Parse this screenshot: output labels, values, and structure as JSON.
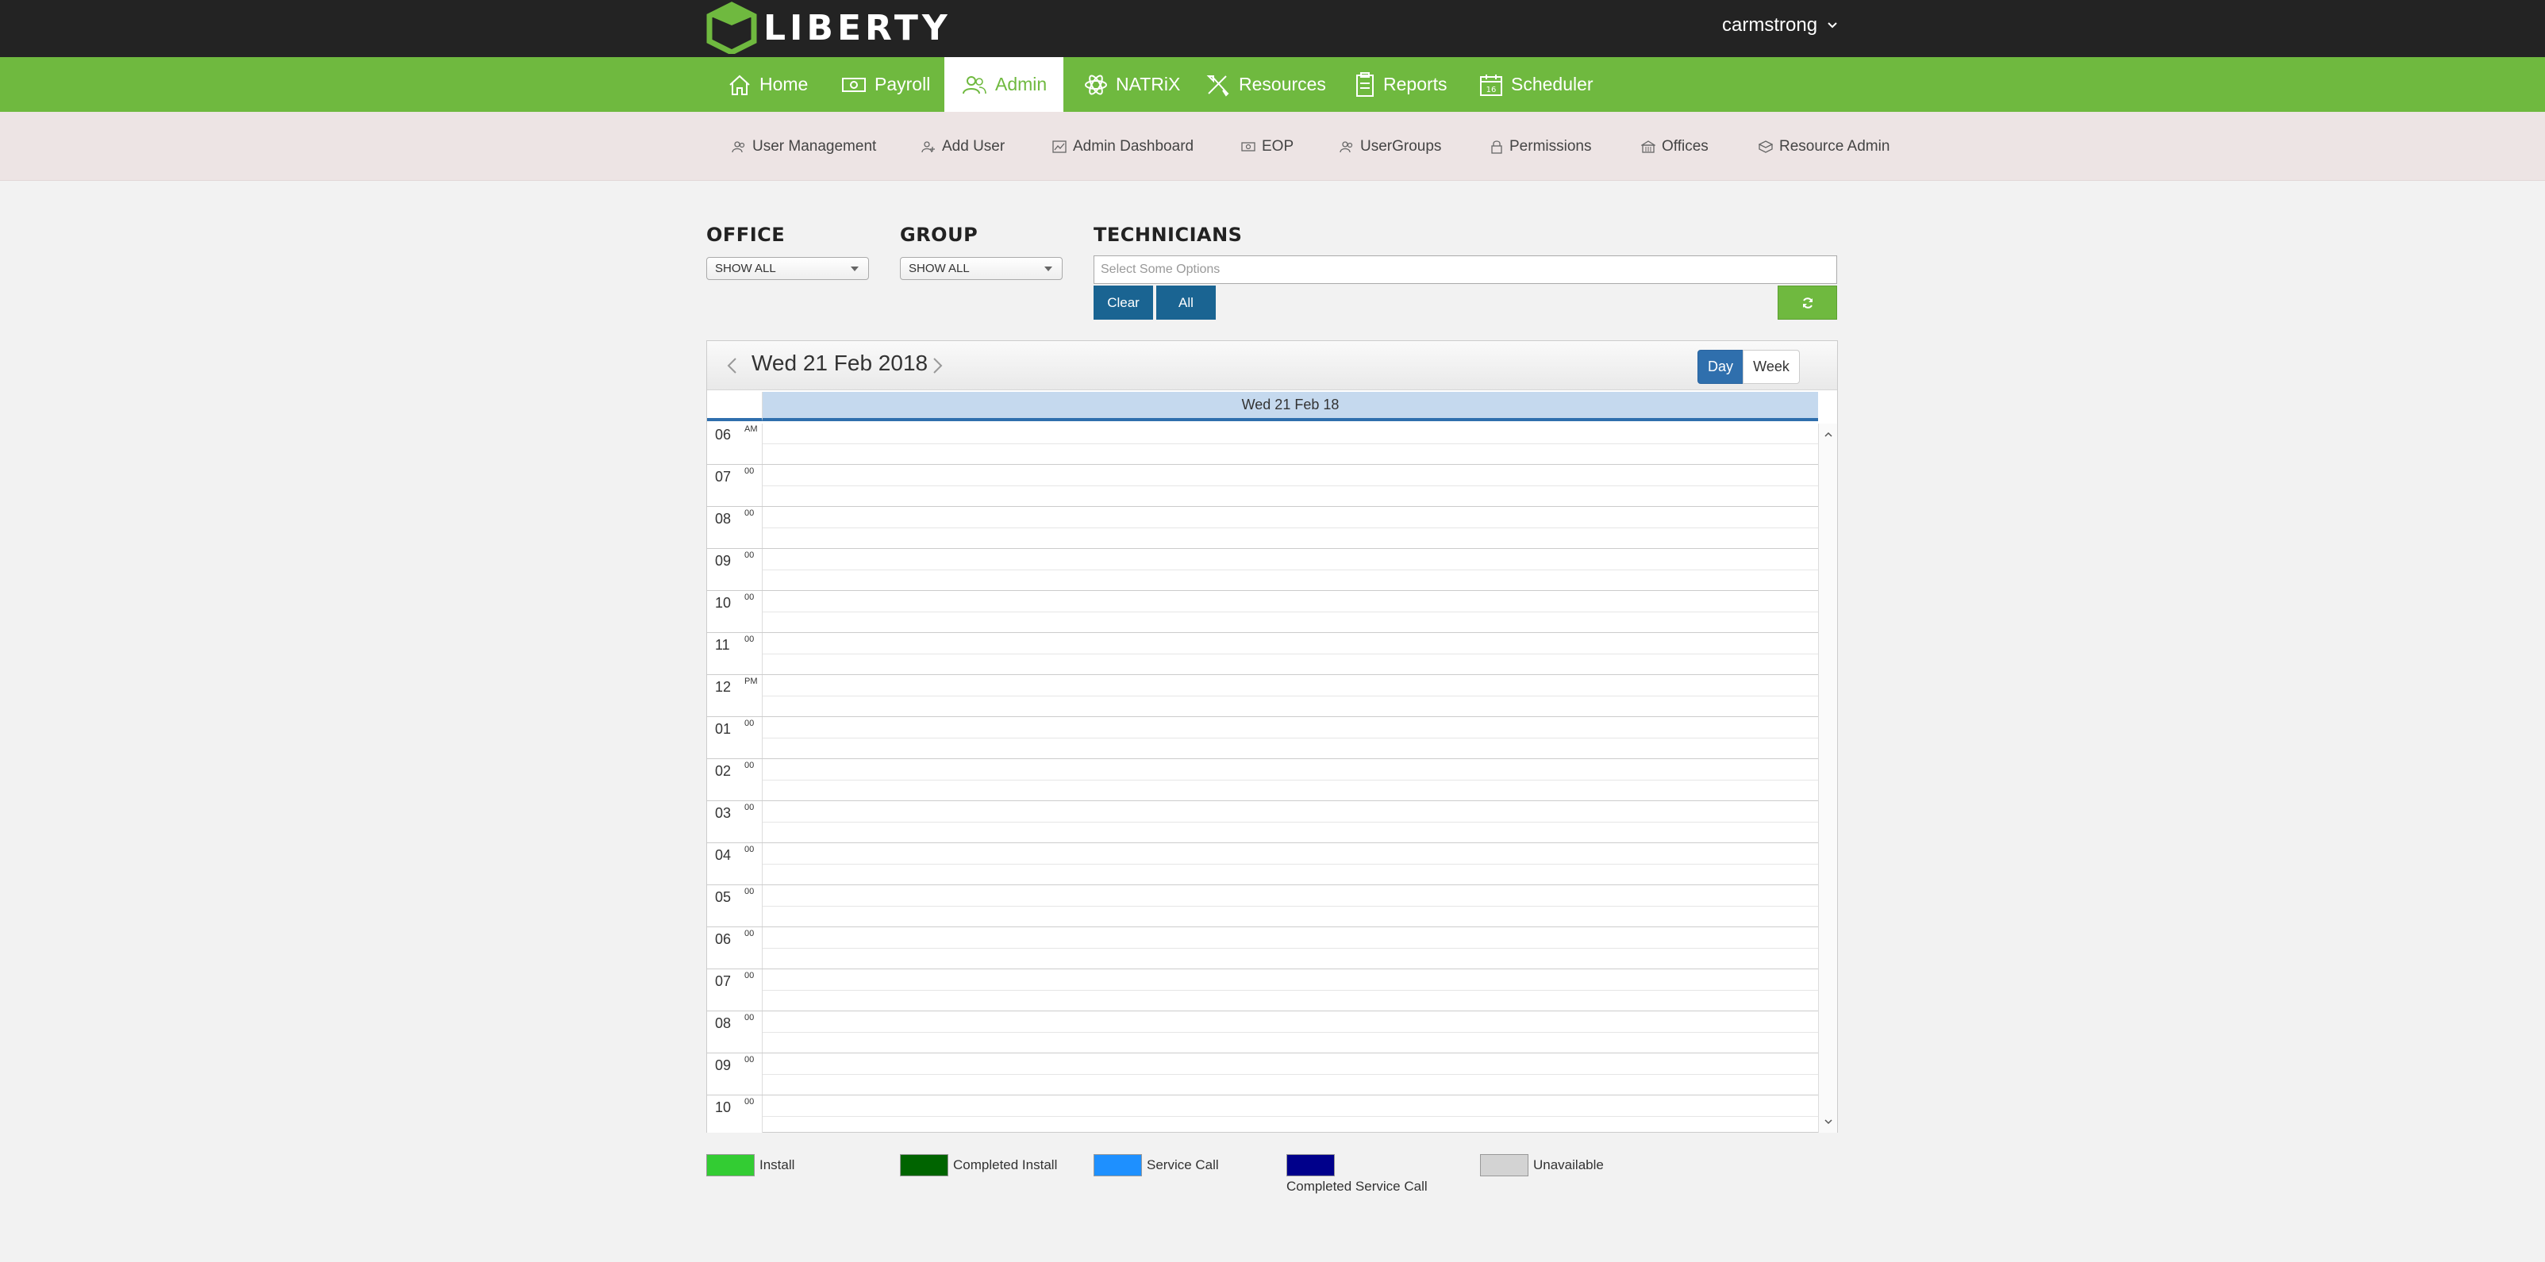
{
  "brand": {
    "name": "LIBERTY",
    "accent": "#6fb93f",
    "topbar": "#232323"
  },
  "user": {
    "name": "carmstrong"
  },
  "mainnav": [
    {
      "label": "Home",
      "icon": "home-icon"
    },
    {
      "label": "Payroll",
      "icon": "money-icon"
    },
    {
      "label": "Admin",
      "icon": "users-icon",
      "active": true
    },
    {
      "label": "NATRiX",
      "icon": "atom-icon"
    },
    {
      "label": "Resources",
      "icon": "tools-icon"
    },
    {
      "label": "Reports",
      "icon": "report-icon"
    },
    {
      "label": "Scheduler",
      "icon": "calendar-icon"
    }
  ],
  "subnav": [
    {
      "label": "User Management",
      "icon": "users-icon"
    },
    {
      "label": "Add User",
      "icon": "add-user-icon"
    },
    {
      "label": "Admin Dashboard",
      "icon": "chart-icon"
    },
    {
      "label": "EOP",
      "icon": "money-icon"
    },
    {
      "label": "UserGroups",
      "icon": "users-icon"
    },
    {
      "label": "Permissions",
      "icon": "lock-icon"
    },
    {
      "label": "Offices",
      "icon": "building-icon"
    },
    {
      "label": "Resource Admin",
      "icon": "box-icon"
    }
  ],
  "filters": {
    "office": {
      "label": "OFFICE",
      "value": "SHOW ALL"
    },
    "group": {
      "label": "GROUP",
      "value": "SHOW ALL"
    },
    "technicians": {
      "label": "TECHNICIANS",
      "placeholder": "Select Some Options"
    },
    "clear_label": "Clear",
    "all_label": "All"
  },
  "calendar": {
    "title": "Wed 21 Feb 2018",
    "column_header": "Wed 21 Feb 18",
    "views": {
      "day": "Day",
      "week": "Week",
      "active": "Day"
    },
    "hours": [
      {
        "h": "06",
        "m": "AM"
      },
      {
        "h": "07",
        "m": "00"
      },
      {
        "h": "08",
        "m": "00"
      },
      {
        "h": "09",
        "m": "00"
      },
      {
        "h": "10",
        "m": "00"
      },
      {
        "h": "11",
        "m": "00"
      },
      {
        "h": "12",
        "m": "PM"
      },
      {
        "h": "01",
        "m": "00"
      },
      {
        "h": "02",
        "m": "00"
      },
      {
        "h": "03",
        "m": "00"
      },
      {
        "h": "04",
        "m": "00"
      },
      {
        "h": "05",
        "m": "00"
      },
      {
        "h": "06",
        "m": "00"
      },
      {
        "h": "07",
        "m": "00"
      },
      {
        "h": "08",
        "m": "00"
      },
      {
        "h": "09",
        "m": "00"
      },
      {
        "h": "10",
        "m": "00"
      }
    ]
  },
  "legend": [
    {
      "label": "Install",
      "color": "#33cc33"
    },
    {
      "label": "Completed Install",
      "color": "#006400"
    },
    {
      "label": "Service Call",
      "color": "#1e90ff"
    },
    {
      "label": "Completed Service Call",
      "color": "#00008b"
    },
    {
      "label": "Unavailable",
      "color": "#d3d3d3"
    }
  ]
}
